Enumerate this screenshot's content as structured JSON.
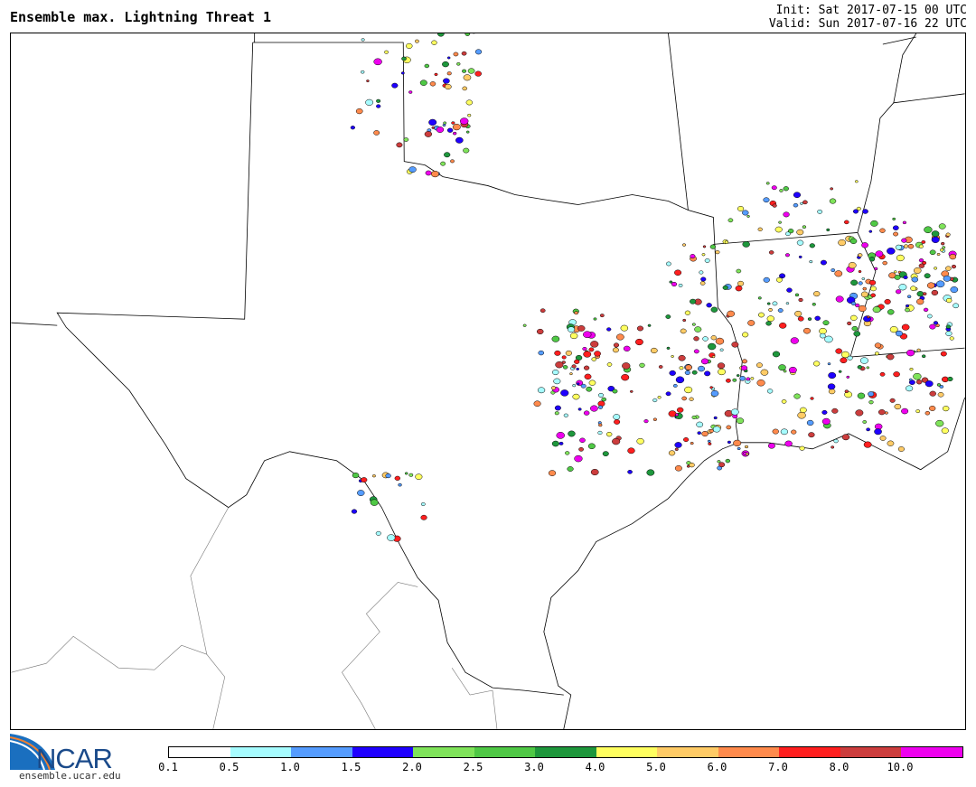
{
  "title": "Ensemble max. Lightning Threat 1",
  "init": "Init: Sat 2017-07-15 00 UTC",
  "valid": "Valid: Sun 2017-07-16 22 UTC",
  "logo": {
    "name": "NCAR",
    "url": "ensemble.ucar.edu"
  },
  "colorbar": {
    "colors": [
      "#ffffff",
      "#a6fcff",
      "#559cff",
      "#1f00ff",
      "#7fe35a",
      "#4fc845",
      "#1e973c",
      "#ffff5f",
      "#ffcb66",
      "#ff8a4c",
      "#ff1f1f",
      "#cc3d3d",
      "#ee00ee"
    ],
    "ticks": [
      "0.1",
      "0.5",
      "1.0",
      "1.5",
      "2.0",
      "2.5",
      "3.0",
      "4.0",
      "5.0",
      "6.0",
      "7.0",
      "8.0",
      "10.0"
    ]
  }
}
